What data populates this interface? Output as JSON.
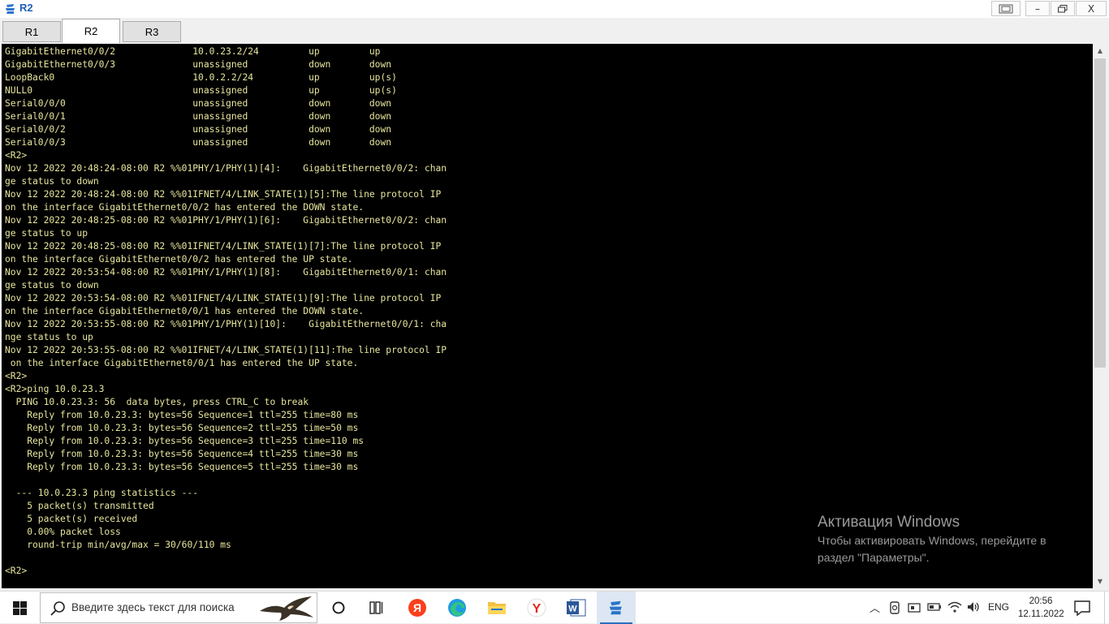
{
  "window": {
    "title": "R2"
  },
  "tabs": [
    {
      "label": "R1",
      "active": false
    },
    {
      "label": "R2",
      "active": true
    },
    {
      "label": "R3",
      "active": false
    }
  ],
  "terminal": {
    "lines": [
      "GigabitEthernet0/0/2              10.0.23.2/24         up         up",
      "GigabitEthernet0/0/3              unassigned           down       down",
      "LoopBack0                         10.0.2.2/24          up         up(s)",
      "NULL0                             unassigned           up         up(s)",
      "Serial0/0/0                       unassigned           down       down",
      "Serial0/0/1                       unassigned           down       down",
      "Serial0/0/2                       unassigned           down       down",
      "Serial0/0/3                       unassigned           down       down",
      "<R2>",
      "Nov 12 2022 20:48:24-08:00 R2 %%01PHY/1/PHY(1)[4]:    GigabitEthernet0/0/2: chan",
      "ge status to down",
      "Nov 12 2022 20:48:24-08:00 R2 %%01IFNET/4/LINK_STATE(1)[5]:The line protocol IP",
      "on the interface GigabitEthernet0/0/2 has entered the DOWN state.",
      "Nov 12 2022 20:48:25-08:00 R2 %%01PHY/1/PHY(1)[6]:    GigabitEthernet0/0/2: chan",
      "ge status to up",
      "Nov 12 2022 20:48:25-08:00 R2 %%01IFNET/4/LINK_STATE(1)[7]:The line protocol IP",
      "on the interface GigabitEthernet0/0/2 has entered the UP state.",
      "Nov 12 2022 20:53:54-08:00 R2 %%01PHY/1/PHY(1)[8]:    GigabitEthernet0/0/1: chan",
      "ge status to down",
      "Nov 12 2022 20:53:54-08:00 R2 %%01IFNET/4/LINK_STATE(1)[9]:The line protocol IP",
      "on the interface GigabitEthernet0/0/1 has entered the DOWN state.",
      "Nov 12 2022 20:53:55-08:00 R2 %%01PHY/1/PHY(1)[10]:    GigabitEthernet0/0/1: cha",
      "nge status to up",
      "Nov 12 2022 20:53:55-08:00 R2 %%01IFNET/4/LINK_STATE(1)[11]:The line protocol IP",
      " on the interface GigabitEthernet0/0/1 has entered the UP state.",
      "<R2>",
      "<R2>ping 10.0.23.3",
      "  PING 10.0.23.3: 56  data bytes, press CTRL_C to break",
      "    Reply from 10.0.23.3: bytes=56 Sequence=1 ttl=255 time=80 ms",
      "    Reply from 10.0.23.3: bytes=56 Sequence=2 ttl=255 time=50 ms",
      "    Reply from 10.0.23.3: bytes=56 Sequence=3 ttl=255 time=110 ms",
      "    Reply from 10.0.23.3: bytes=56 Sequence=4 ttl=255 time=30 ms",
      "    Reply from 10.0.23.3: bytes=56 Sequence=5 ttl=255 time=30 ms",
      "",
      "  --- 10.0.23.3 ping statistics ---",
      "    5 packet(s) transmitted",
      "    5 packet(s) received",
      "    0.00% packet loss",
      "    round-trip min/avg/max = 30/60/110 ms",
      "",
      "<R2>"
    ]
  },
  "activation": {
    "title": "Активация Windows",
    "line1": "Чтобы активировать Windows, перейдите в",
    "line2": "раздел \"Параметры\"."
  },
  "taskbar": {
    "search_placeholder": "Введите здесь текст для поиска",
    "language": "ENG",
    "time": "20:56",
    "date": "12.11.2022"
  },
  "colors": {
    "terminal_bg": "#000000",
    "terminal_fg": "#e8e69d",
    "accent": "#2a6ebd"
  }
}
